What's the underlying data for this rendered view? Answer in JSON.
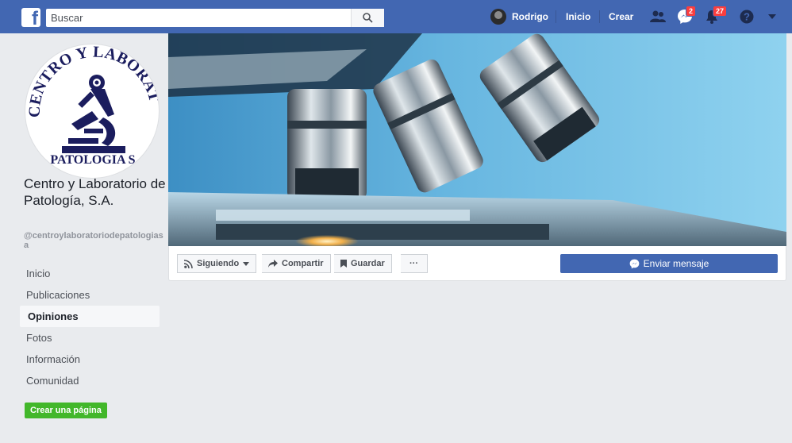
{
  "topbar": {
    "search_placeholder": "Buscar",
    "user_name": "Rodrigo",
    "home_label": "Inicio",
    "create_label": "Crear",
    "messages_badge": "2",
    "notifications_badge": "27",
    "brand_color": "#4267b2",
    "badge_color": "#fa3e3e"
  },
  "page": {
    "logo_text_top": "CENTRO Y LABORATORIO",
    "logo_text_bottom": "PATOLOGIA S",
    "name": "Centro y Laboratorio de Patología, S.A.",
    "handle": "@centroylaboratoriodepatologiasa"
  },
  "sidebar": {
    "items": [
      {
        "label": "Inicio"
      },
      {
        "label": "Publicaciones"
      },
      {
        "label": "Opiniones"
      },
      {
        "label": "Fotos"
      },
      {
        "label": "Información"
      },
      {
        "label": "Comunidad"
      }
    ],
    "create_page_label": "Crear una página",
    "create_color": "#42b72a"
  },
  "actions": {
    "following_label": "Siguiendo",
    "share_label": "Compartir",
    "save_label": "Guardar",
    "more_label": "···",
    "message_label": "Enviar mensaje"
  }
}
